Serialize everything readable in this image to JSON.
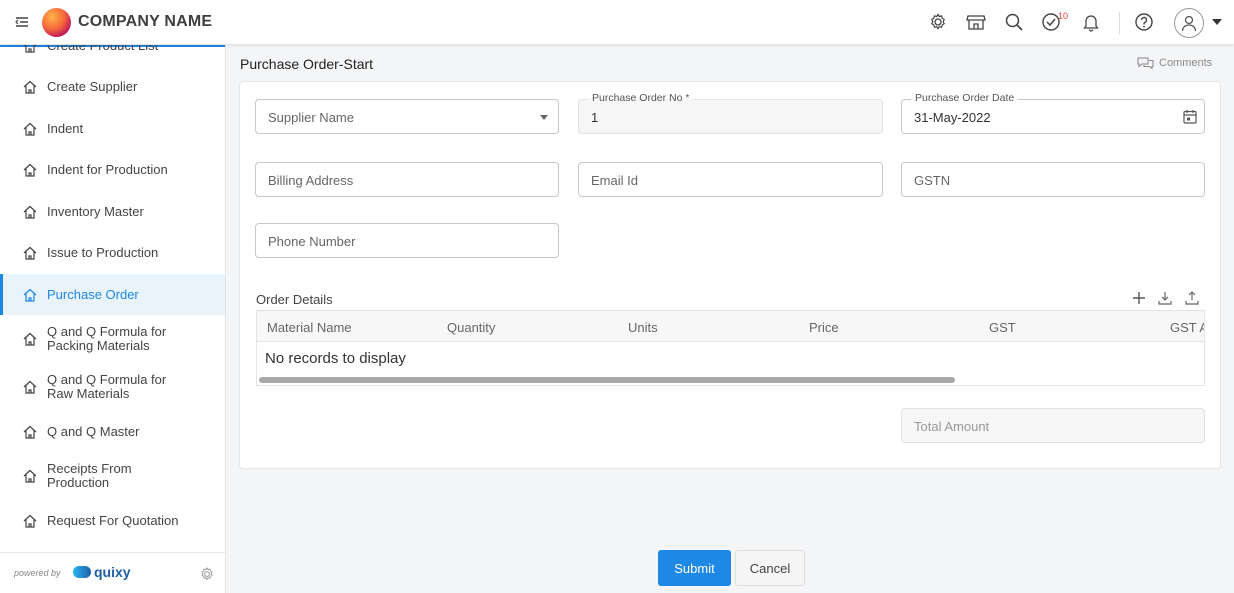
{
  "header": {
    "company_name": "COMPANY NAME",
    "tasks_badge": "10",
    "icons": [
      "menu-toggle-icon",
      "settings-icon",
      "store-icon",
      "search-icon",
      "tasks-icon",
      "bell-icon",
      "help-icon",
      "user-icon"
    ]
  },
  "sidebar": {
    "clipped_item": "Create Product List",
    "items": [
      {
        "label": "Create Supplier"
      },
      {
        "label": "Indent"
      },
      {
        "label": "Indent for Production"
      },
      {
        "label": "Inventory Master"
      },
      {
        "label": "Issue to Production"
      },
      {
        "label": "Purchase Order",
        "active": true
      },
      {
        "label": "Q and Q Formula for Packing Materials"
      },
      {
        "label": "Q and Q Formula for Raw Materials"
      },
      {
        "label": "Q and Q Master"
      },
      {
        "label": "Receipts From Production"
      },
      {
        "label": "Request For Quotation"
      }
    ],
    "footer": {
      "powered_by": "powered by",
      "brand": "quixy"
    }
  },
  "main": {
    "title": "Purchase Order-Start",
    "comments_label": "Comments",
    "form": {
      "supplier_name_placeholder": "Supplier Name",
      "po_no_label": "Purchase Order No *",
      "po_no_value": "1",
      "po_date_label": "Purchase Order Date",
      "po_date_value": "31-May-2022",
      "billing_address_placeholder": "Billing Address",
      "email_placeholder": "Email Id",
      "gstn_placeholder": "GSTN",
      "phone_placeholder": "Phone Number",
      "total_amount_placeholder": "Total Amount"
    },
    "order_details": {
      "label": "Order Details",
      "columns": [
        "Material Name",
        "Quantity",
        "Units",
        "Price",
        "GST",
        "GST Amount"
      ],
      "empty_message": "No records to display"
    },
    "actions": {
      "submit": "Submit",
      "cancel": "Cancel"
    }
  },
  "colors": {
    "accent": "#1e88e5",
    "active_bg": "#e8f3fb",
    "badge": "#e53935"
  }
}
